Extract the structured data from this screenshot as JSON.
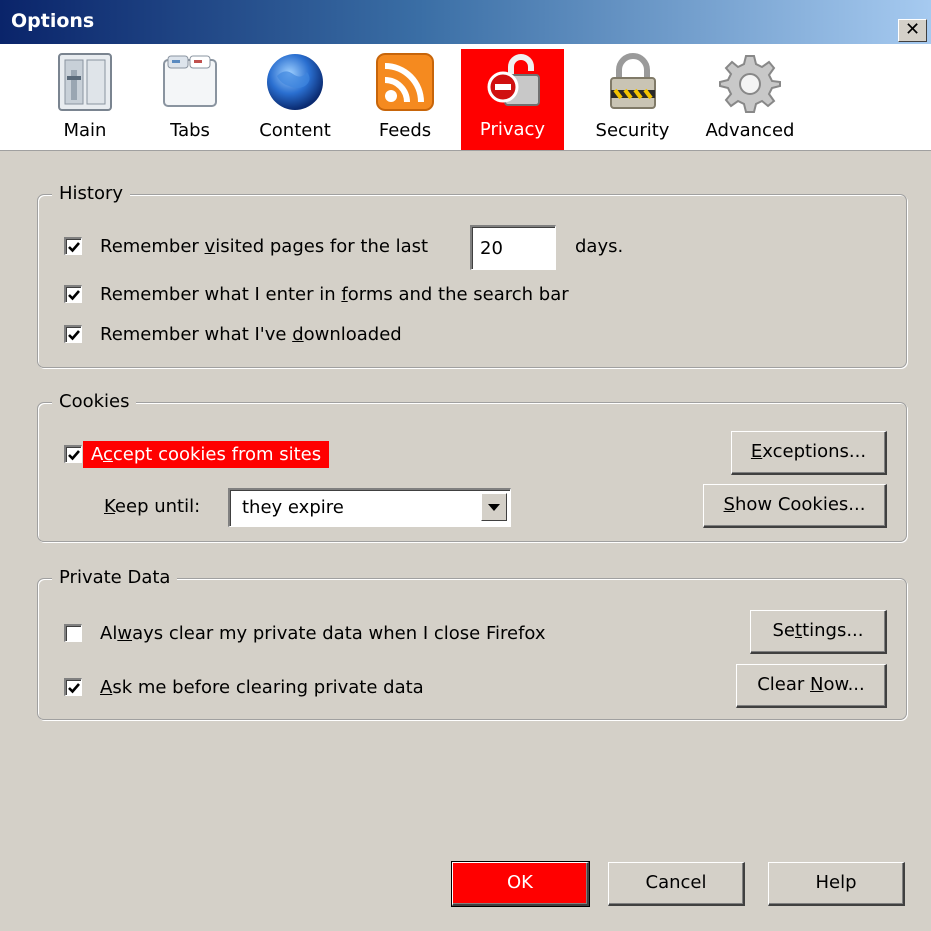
{
  "window": {
    "title": "Options",
    "close_glyph": "✕"
  },
  "toolbar": {
    "items": [
      {
        "label": "Main",
        "icon": "main-icon"
      },
      {
        "label": "Tabs",
        "icon": "tabs-icon"
      },
      {
        "label": "Content",
        "icon": "globe-icon"
      },
      {
        "label": "Feeds",
        "icon": "rss-icon"
      },
      {
        "label": "Privacy",
        "icon": "privacy-icon",
        "selected": true
      },
      {
        "label": "Security",
        "icon": "padlock-icon"
      },
      {
        "label": "Advanced",
        "icon": "gear-icon"
      }
    ]
  },
  "history": {
    "legend": "History",
    "visited": {
      "pre": "Remember ",
      "u": "v",
      "post": "isited pages for the last",
      "checked": true
    },
    "days_value": "20",
    "days_suffix": "days.",
    "forms": {
      "pre": "Remember what I enter in ",
      "u": "f",
      "post": "orms and the search bar",
      "checked": true
    },
    "downloads": {
      "pre": "Remember what I've ",
      "u": "d",
      "post": "ownloaded",
      "checked": true
    }
  },
  "cookies": {
    "legend": "Cookies",
    "accept": {
      "pre": "A",
      "u": "c",
      "post": "cept cookies from sites",
      "checked": true
    },
    "keep_until": {
      "pre": "",
      "u": "K",
      "post": "eep until:"
    },
    "keep_value": "they expire",
    "exceptions": {
      "pre": "",
      "u": "E",
      "post": "xceptions..."
    },
    "show_cookies": {
      "pre": "",
      "u": "S",
      "post": "how Cookies..."
    }
  },
  "private_data": {
    "legend": "Private Data",
    "always_clear": {
      "pre": "Al",
      "u": "w",
      "post": "ays clear my private data when I close Firefox",
      "checked": false
    },
    "ask": {
      "pre": "",
      "u": "A",
      "post": "sk me before clearing private data",
      "checked": true
    },
    "settings": {
      "pre": "Se",
      "u": "t",
      "post": "tings..."
    },
    "clear_now": {
      "pre": "Clear ",
      "u": "N",
      "post": "ow..."
    }
  },
  "footer": {
    "ok": "OK",
    "cancel": "Cancel",
    "help": "Help"
  },
  "colors": {
    "highlight": "#ff0000",
    "face": "#d4d0c8",
    "title_start": "#0a246a"
  }
}
